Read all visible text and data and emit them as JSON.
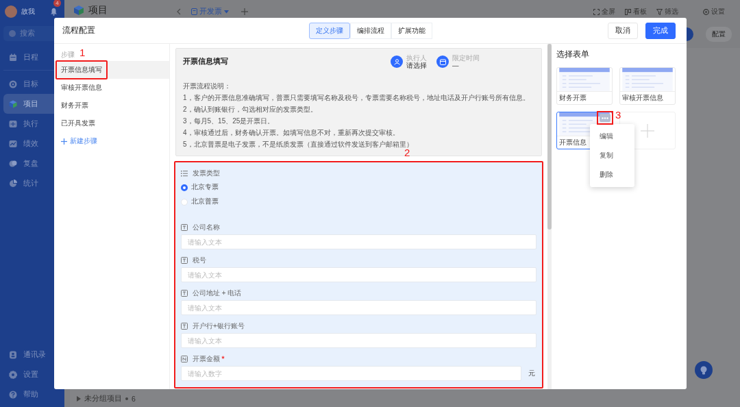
{
  "sidebar": {
    "user": {
      "name": "故我",
      "notifications": "4"
    },
    "search": {
      "label": "搜索"
    },
    "items": [
      {
        "label": "日程",
        "selected": false
      },
      {
        "label": "目标",
        "selected": false
      },
      {
        "label": "项目",
        "selected": true
      },
      {
        "label": "执行",
        "selected": false
      },
      {
        "label": "绩效",
        "selected": false
      },
      {
        "label": "复盘",
        "selected": false
      },
      {
        "label": "统计",
        "selected": false
      }
    ],
    "bottom_items": [
      {
        "label": "通讯录"
      },
      {
        "label": "设置"
      },
      {
        "label": "帮助"
      }
    ]
  },
  "topbar": {
    "title": "项目",
    "view_tab": {
      "label": "开发票"
    },
    "actions": [
      {
        "label": "全屏"
      },
      {
        "label": "看板"
      },
      {
        "label": "筛选"
      },
      {
        "label": "设置"
      }
    ]
  },
  "toolbar": {
    "buttons": [
      {
        "label": "配置"
      }
    ]
  },
  "group_row": {
    "label": "未分组项目",
    "count": "6"
  },
  "dialog": {
    "title": "流程配置",
    "tabs": [
      {
        "label": "定义步骤",
        "selected": true
      },
      {
        "label": "编排流程",
        "selected": false
      },
      {
        "label": "扩展功能",
        "selected": false
      }
    ],
    "buttons": [
      {
        "label": "取消",
        "kind": "secondary"
      },
      {
        "label": "完成",
        "kind": "primary"
      }
    ],
    "steps": {
      "heading": "步骤",
      "items": [
        {
          "label": "开票信息填写",
          "selected": true,
          "annotation": "1"
        },
        {
          "label": "审核开票信息",
          "selected": false
        },
        {
          "label": "财务开票",
          "selected": false
        },
        {
          "label": "已开具发票",
          "selected": false
        }
      ],
      "add_label": "新建步骤"
    },
    "step_card": {
      "title": "开票信息填写",
      "assignee": {
        "label": "执行人",
        "value": "请选择"
      },
      "deadline": {
        "label": "限定时间",
        "value": "—"
      },
      "description": [
        "开票流程说明：",
        "1，客户的开票信息准确填写，普票只需要填写名称及税号，专票需要名称税号，地址电话及开户行账号所有信息。",
        "2，确认到账银行，勾选相对应的发票类型。",
        "3，每月5、15、25是开票日。",
        "4，审核通过后，财务确认开票。如填写信息不对，重新再次提交审核。",
        "5，北京普票是电子发票，不是纸质发票（直接通过软件发送到客户邮箱里）"
      ]
    },
    "form": {
      "annotation": "2",
      "fields": [
        {
          "kind": "radio",
          "label": "发票类型",
          "options": [
            {
              "label": "北京专票",
              "selected": true
            },
            {
              "label": "北京普票",
              "selected": false
            }
          ]
        },
        {
          "kind": "text",
          "label": "公司名称",
          "placeholder": "请输入文本"
        },
        {
          "kind": "text",
          "label": "税号",
          "placeholder": "请输入文本"
        },
        {
          "kind": "text",
          "label": "公司地址 + 电话",
          "placeholder": "请输入文本"
        },
        {
          "kind": "text",
          "label": "开户行+银行账号",
          "placeholder": "请输入文本"
        },
        {
          "kind": "number",
          "label": "开票金额",
          "required": true,
          "placeholder": "请输入数字",
          "suffix": "元"
        }
      ]
    },
    "form_picker": {
      "title": "选择表单",
      "forms": [
        {
          "label": "财务开票",
          "selected": false
        },
        {
          "label": "审核开票信息",
          "selected": false
        },
        {
          "label": "开票信息",
          "selected": true,
          "menu_annotation": "3"
        }
      ],
      "menu": [
        "编辑",
        "复制",
        "删除"
      ]
    }
  }
}
